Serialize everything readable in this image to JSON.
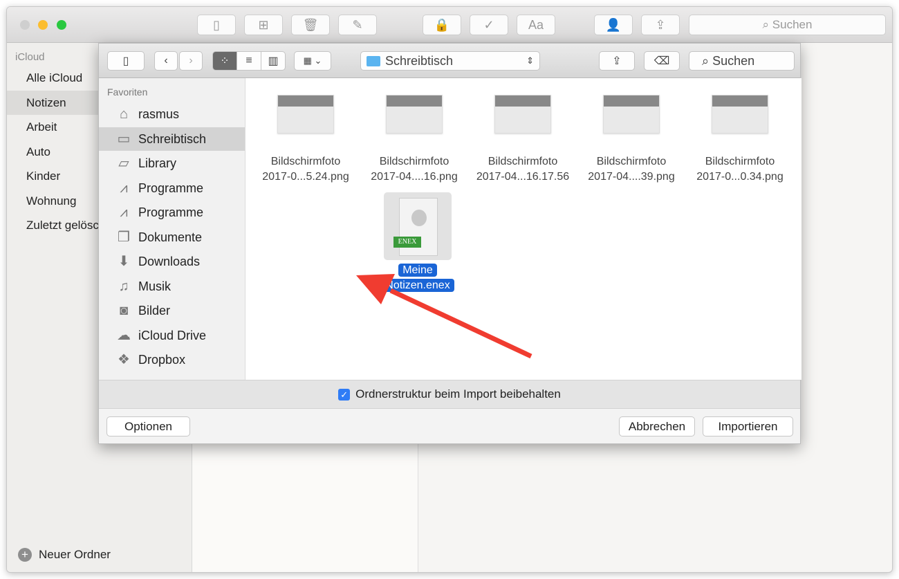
{
  "app": {
    "sidebar_header": "iCloud",
    "folders": [
      "Alle iCloud",
      "Notizen",
      "Arbeit",
      "Auto",
      "Kinder",
      "Wohnung",
      "Zuletzt gelöscht"
    ],
    "selected_folder": "Notizen",
    "new_folder": "Neuer Ordner",
    "search_placeholder": "Suchen",
    "font_button": "Aa"
  },
  "dialog": {
    "path": "Schreibtisch",
    "search_placeholder": "Suchen",
    "favorites_header": "Favoriten",
    "favorites": [
      {
        "label": "rasmus",
        "icon": "home-icon"
      },
      {
        "label": "Schreibtisch",
        "icon": "desktop-icon"
      },
      {
        "label": "Library",
        "icon": "folder-icon"
      },
      {
        "label": "Programme",
        "icon": "applications-icon"
      },
      {
        "label": "Programme",
        "icon": "applications-icon"
      },
      {
        "label": "Dokumente",
        "icon": "documents-icon"
      },
      {
        "label": "Downloads",
        "icon": "downloads-icon"
      },
      {
        "label": "Musik",
        "icon": "music-icon"
      },
      {
        "label": "Bilder",
        "icon": "camera-icon"
      },
      {
        "label": "iCloud Drive",
        "icon": "cloud-icon"
      },
      {
        "label": "Dropbox",
        "icon": "dropbox-icon"
      }
    ],
    "selected_favorite": "Schreibtisch",
    "files": [
      {
        "line1": "Bildschirmfoto",
        "line2": "2017-0...5.24.png"
      },
      {
        "line1": "Bildschirmfoto",
        "line2": "2017-04....16.png"
      },
      {
        "line1": "Bildschirmfoto",
        "line2": "2017-04...16.17.56"
      },
      {
        "line1": "Bildschirmfoto",
        "line2": "2017-04....39.png"
      },
      {
        "line1": "Bildschirmfoto",
        "line2": "2017-0...0.34.png"
      }
    ],
    "selected_file": {
      "line1": "Meine",
      "line2": "Notizen.enex",
      "badge": "ENEX"
    },
    "checkbox_label": "Ordnerstruktur beim Import beibehalten",
    "checkbox_checked": true,
    "options": "Optionen",
    "cancel": "Abbrechen",
    "import": "Importieren"
  },
  "colors": {
    "accent": "#2f7cf6",
    "selection": "#1a65d6",
    "arrow": "#f03c30",
    "enex": "#3a9a3a"
  }
}
